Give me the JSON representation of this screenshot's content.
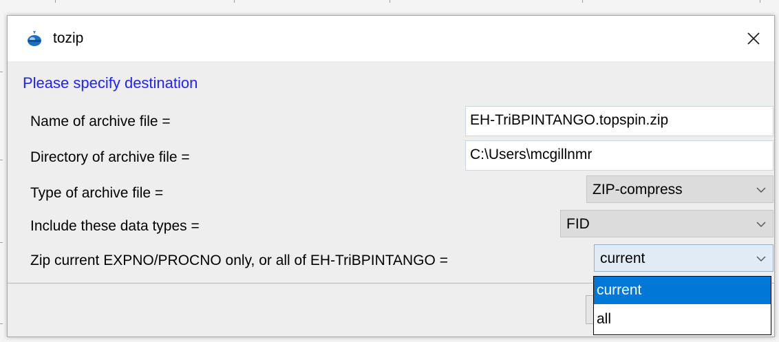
{
  "window": {
    "title": "tozip",
    "app_icon": "topspin-icon",
    "close_icon": "close-icon"
  },
  "form": {
    "heading": "Please specify destination",
    "rows": [
      {
        "label": "Name of archive file =",
        "type": "text",
        "value": "EH-TriBPINTANGO.topspin.zip"
      },
      {
        "label": "Directory of archive file =",
        "type": "text",
        "value": "C:\\Users\\mcgillnmr"
      },
      {
        "label": "Type of archive file =",
        "type": "select",
        "value": "ZIP-compress"
      },
      {
        "label": "Include these data types =",
        "type": "select",
        "value": "FID"
      },
      {
        "label": "Zip current EXPNO/PROCNO only, or all of EH-TriBPINTANGO =",
        "type": "select",
        "value": "current"
      }
    ]
  },
  "dropdown": {
    "options": [
      "current",
      "all"
    ],
    "highlighted": "current"
  },
  "colors": {
    "heading": "#1f1fff",
    "selection": "#0078d7",
    "dialog_bg": "#eeeeee"
  }
}
